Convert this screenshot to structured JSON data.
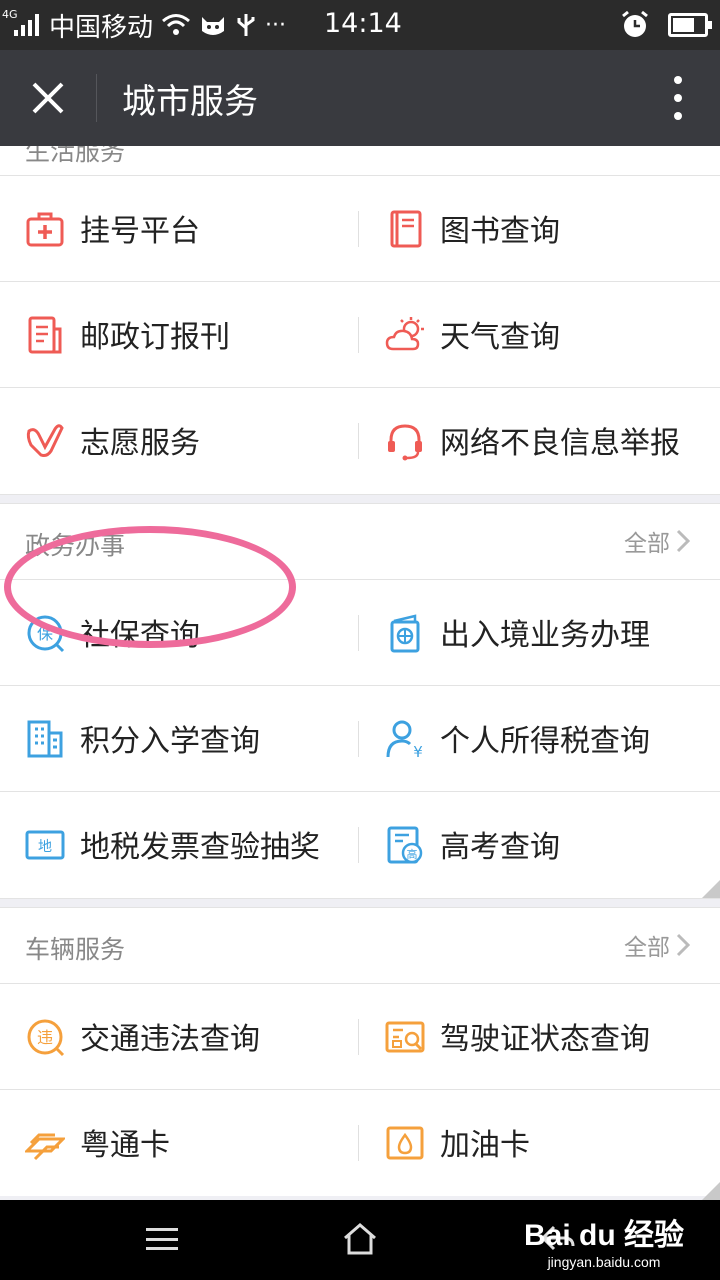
{
  "status_bar": {
    "network": "4G",
    "carrier": "中国移动",
    "dots": "···",
    "time": "14:14",
    "battery_level": 0.7
  },
  "title_bar": {
    "title": "城市服务"
  },
  "colors": {
    "red_icon": "#ef5b55",
    "blue_icon": "#3da1e0",
    "orange_icon": "#f5a03c",
    "highlight": "#ee6b9b"
  },
  "sections": {
    "top": {
      "partial_title": "生活服务",
      "rows": [
        [
          {
            "icon": "medical-bag-icon",
            "label": "挂号平台"
          },
          {
            "icon": "book-icon",
            "label": "图书查询"
          }
        ],
        [
          {
            "icon": "newspaper-icon",
            "label": "邮政订报刊"
          },
          {
            "icon": "weather-icon",
            "label": "天气查询"
          }
        ],
        [
          {
            "icon": "heart-hand-icon",
            "label": "志愿服务"
          },
          {
            "icon": "headset-icon",
            "label": "网络不良信息举报"
          }
        ]
      ]
    },
    "gov": {
      "title": "政务办事",
      "all_label": "全部",
      "rows": [
        [
          {
            "icon": "bao-icon",
            "label": "社保查询"
          },
          {
            "icon": "passport-icon",
            "label": "出入境业务办理"
          }
        ],
        [
          {
            "icon": "building-icon",
            "label": "积分入学查询"
          },
          {
            "icon": "person-tax-icon",
            "label": "个人所得税查询"
          }
        ],
        [
          {
            "icon": "di-invoice-icon",
            "label": "地税发票查验抽奖"
          },
          {
            "icon": "gaokao-icon",
            "label": "高考查询"
          }
        ]
      ]
    },
    "vehicle": {
      "title": "车辆服务",
      "all_label": "全部",
      "rows": [
        [
          {
            "icon": "wei-icon",
            "label": "交通违法查询"
          },
          {
            "icon": "license-icon",
            "label": "驾驶证状态查询"
          }
        ],
        [
          {
            "icon": "yuetong-card-icon",
            "label": "粤通卡"
          },
          {
            "icon": "fuel-card-icon",
            "label": "加油卡"
          }
        ]
      ]
    }
  },
  "icon_glyphs": {
    "bao": "保",
    "di": "地",
    "wei": "违",
    "gao": "高",
    "yen": "¥"
  },
  "watermark": {
    "logo": "Bai du 经验",
    "url": "jingyan.baidu.com"
  }
}
